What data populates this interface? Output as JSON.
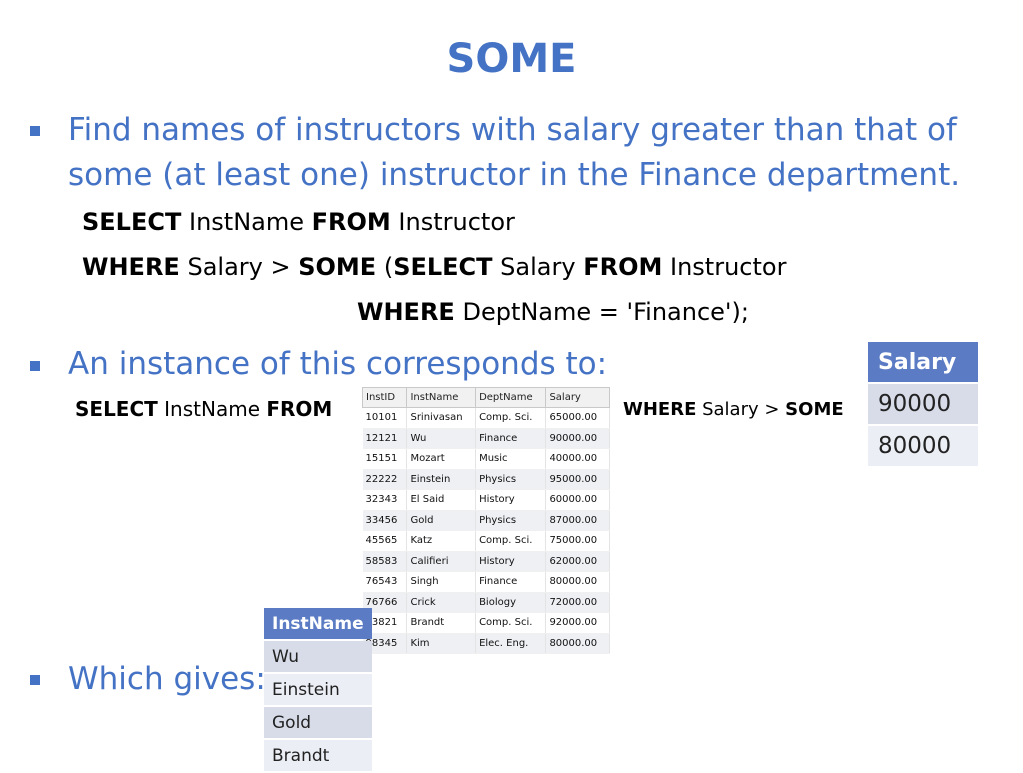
{
  "slide": {
    "title": "SOME",
    "bullet1": {
      "line1": "Find names of instructors with salary greater than that of",
      "line2": "some (at least one) instructor in the Finance department."
    },
    "query": {
      "l1_kw1": "SELECT",
      "l1_t1": " InstName ",
      "l1_kw2": "FROM",
      "l1_t2": " Instructor",
      "l2_kw1": "WHERE",
      "l2_t1": " Salary > ",
      "l2_kw2": "SOME",
      "l2_t2": " (",
      "l2_kw3": "SELECT",
      "l2_t3": " Salary ",
      "l2_kw4": "FROM",
      "l2_t4": " Instructor",
      "l3_kw1": "WHERE",
      "l3_t1": " DeptName = 'Finance');"
    },
    "bullet2": "An instance of this corresponds to:",
    "instance": {
      "left_kw1": "SELECT",
      "left_t1": " InstName ",
      "left_kw2": "FROM",
      "right_kw1": "WHERE",
      "right_t1": " Salary > ",
      "right_kw2": "SOME"
    },
    "bullet3": "Which gives:"
  },
  "instructor_table": {
    "headers": [
      "InstID",
      "InstName",
      "DeptName",
      "Salary"
    ],
    "rows": [
      [
        "10101",
        "Srinivasan",
        "Comp. Sci.",
        "65000.00"
      ],
      [
        "12121",
        "Wu",
        "Finance",
        "90000.00"
      ],
      [
        "15151",
        "Mozart",
        "Music",
        "40000.00"
      ],
      [
        "22222",
        "Einstein",
        "Physics",
        "95000.00"
      ],
      [
        "32343",
        "El Said",
        "History",
        "60000.00"
      ],
      [
        "33456",
        "Gold",
        "Physics",
        "87000.00"
      ],
      [
        "45565",
        "Katz",
        "Comp. Sci.",
        "75000.00"
      ],
      [
        "58583",
        "Califieri",
        "History",
        "62000.00"
      ],
      [
        "76543",
        "Singh",
        "Finance",
        "80000.00"
      ],
      [
        "76766",
        "Crick",
        "Biology",
        "72000.00"
      ],
      [
        "83821",
        "Brandt",
        "Comp. Sci.",
        "92000.00"
      ],
      [
        "98345",
        "Kim",
        "Elec. Eng.",
        "80000.00"
      ]
    ]
  },
  "salary_table": {
    "header": "Salary",
    "rows": [
      "90000",
      "80000"
    ]
  },
  "result_table": {
    "header": "InstName",
    "rows": [
      "Wu",
      "Einstein",
      "Gold",
      "Brandt"
    ]
  },
  "colors": {
    "accent": "#4472c4",
    "table_header": "#5b7cc4",
    "row_dark": "#d7dce8",
    "row_light": "#ebeef4"
  }
}
